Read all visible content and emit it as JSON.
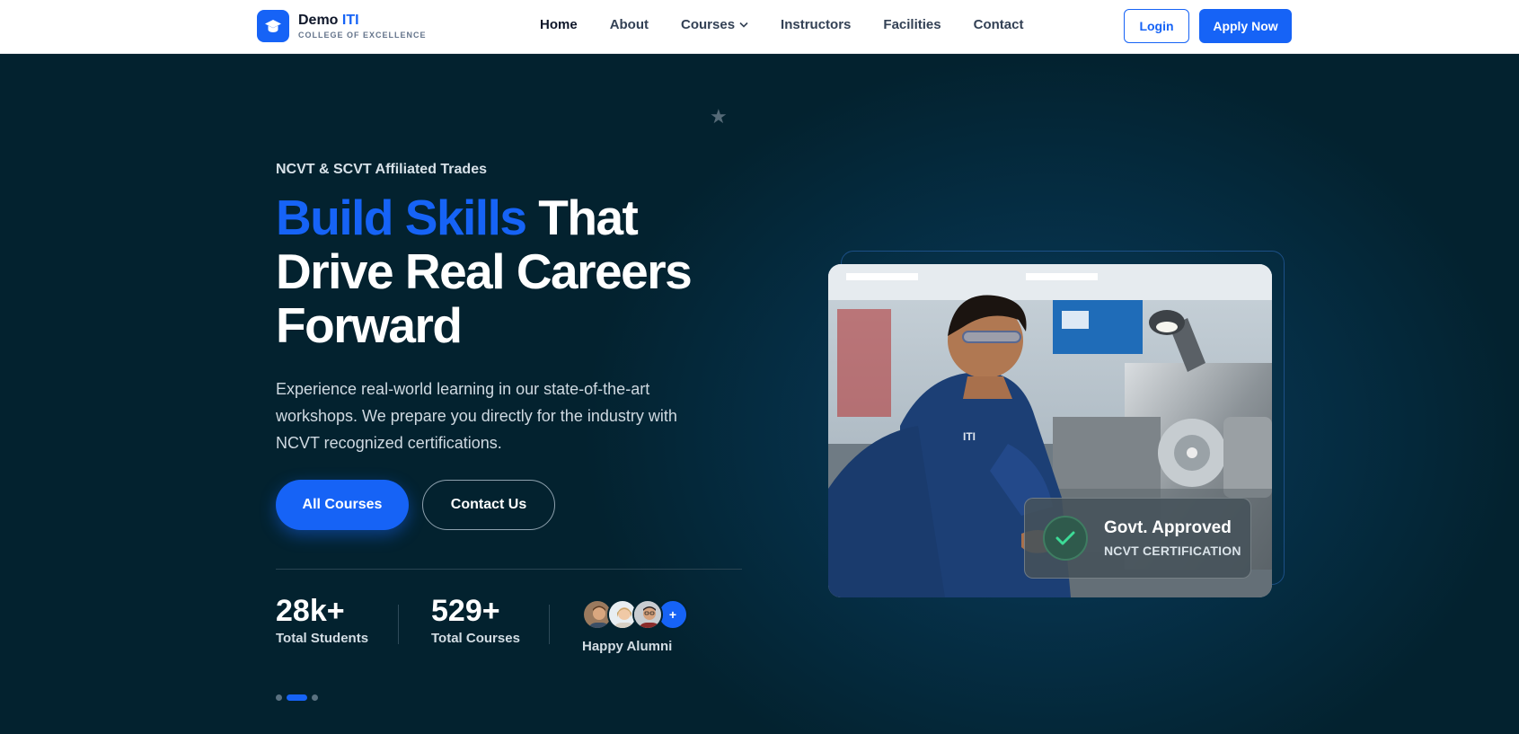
{
  "brand": {
    "name": "Demo",
    "name_accent": "ITI",
    "tagline": "COLLEGE OF EXCELLENCE"
  },
  "nav": {
    "items": [
      {
        "label": "Home",
        "active": true
      },
      {
        "label": "About",
        "active": false
      },
      {
        "label": "Courses",
        "active": false,
        "has_dropdown": true
      },
      {
        "label": "Instructors",
        "active": false
      },
      {
        "label": "Facilities",
        "active": false
      },
      {
        "label": "Contact",
        "active": false
      }
    ],
    "login_label": "Login",
    "apply_label": "Apply Now"
  },
  "hero": {
    "eyebrow": "NCVT & SCVT Affiliated Trades",
    "headline_highlight": "Build Skills",
    "headline_rest": "That Drive Real Careers Forward",
    "description": "Experience real-world learning in our state-of-the-art workshops. We prepare you directly for the industry with NCVT recognized certifications.",
    "primary_cta": "All Courses",
    "secondary_cta": "Contact Us",
    "stats": [
      {
        "value": "28k+",
        "label": "Total Students"
      },
      {
        "value": "529+",
        "label": "Total Courses"
      }
    ],
    "alumni": {
      "label": "Happy Alumni",
      "more_label": "+"
    },
    "slides": {
      "count": 3,
      "active_index": 1
    }
  },
  "badge": {
    "title": "Govt. Approved",
    "subtitle": "NCVT CERTIFICATION"
  },
  "colors": {
    "primary": "#1663f6",
    "hero_bg": "#03222f",
    "white": "#ffffff"
  },
  "icons": {
    "logo": "graduation-cap-icon",
    "dropdown": "chevron-down-icon",
    "badge": "check-icon",
    "decor": "star-icon"
  }
}
